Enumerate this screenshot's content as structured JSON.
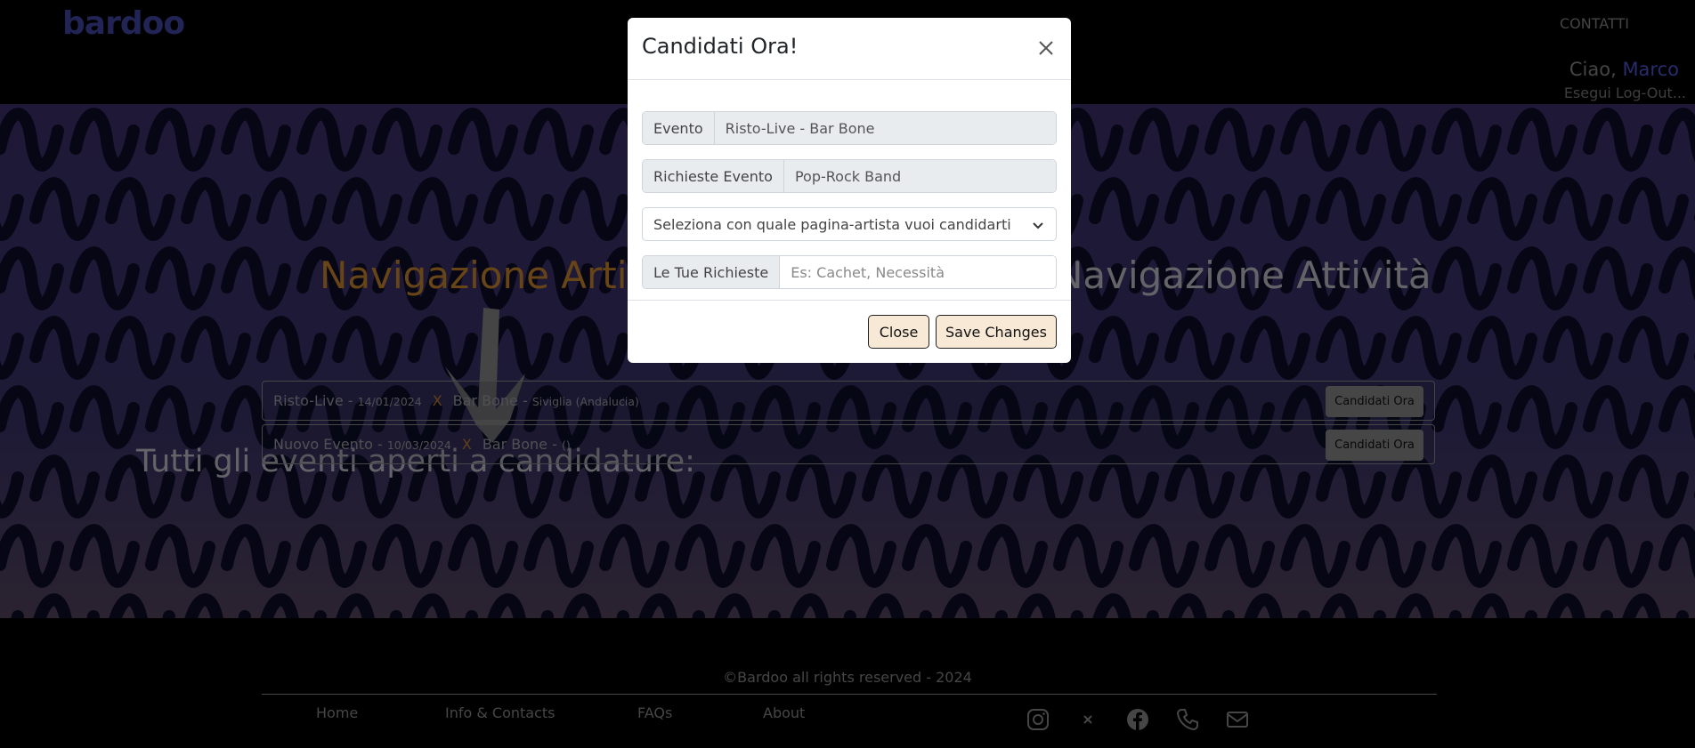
{
  "header": {
    "logo": "bardoo",
    "contact_link": "CONTATTI",
    "greeting": "Ciao,",
    "user_name": "Marco",
    "logout": "Esegui Log-Out..."
  },
  "hero": {
    "nav_artisti": "Navigazione Artisti",
    "nav_attivita": "Navigazione Attività",
    "events_title": "Tutti gli eventi aperti a candidature:"
  },
  "events": [
    {
      "name": "Risto-Live - ",
      "date": "14/01/2024",
      "sep": "X",
      "venue": "Bar Bone - ",
      "location": "Siviglia (Andalucia)",
      "button": "Candidati Ora"
    },
    {
      "name": "Nuovo Evento - ",
      "date": "10/03/2024",
      "sep": "X",
      "venue": "Bar Bone - ",
      "location": "()",
      "button": "Candidati Ora"
    }
  ],
  "footer": {
    "copyright": "©Bardoo all rights reserved - 2024",
    "links": [
      "Home",
      "Info & Contacts",
      "FAQs",
      "About"
    ],
    "icons": [
      "instagram-icon",
      "x-icon",
      "facebook-icon",
      "phone-icon",
      "mail-icon"
    ]
  },
  "modal": {
    "title": "Candidati Ora!",
    "evento_label": "Evento",
    "evento_value": "Risto-Live - Bar Bone",
    "richieste_label": "Richieste Evento",
    "richieste_value": "Pop-Rock Band",
    "select_value": "Seleziona con quale pagina-artista vuoi candidarti",
    "tue_richieste_label": "Le Tue Richieste",
    "tue_richieste_placeholder": "Es: Cachet, Necessità",
    "close_button": "Close",
    "save_button": "Save Changes"
  },
  "colors": {
    "brand": "#4348a8",
    "accent": "#d08a2e",
    "user": "#5058d6",
    "modal_button_bg": "#f8e9d6"
  }
}
